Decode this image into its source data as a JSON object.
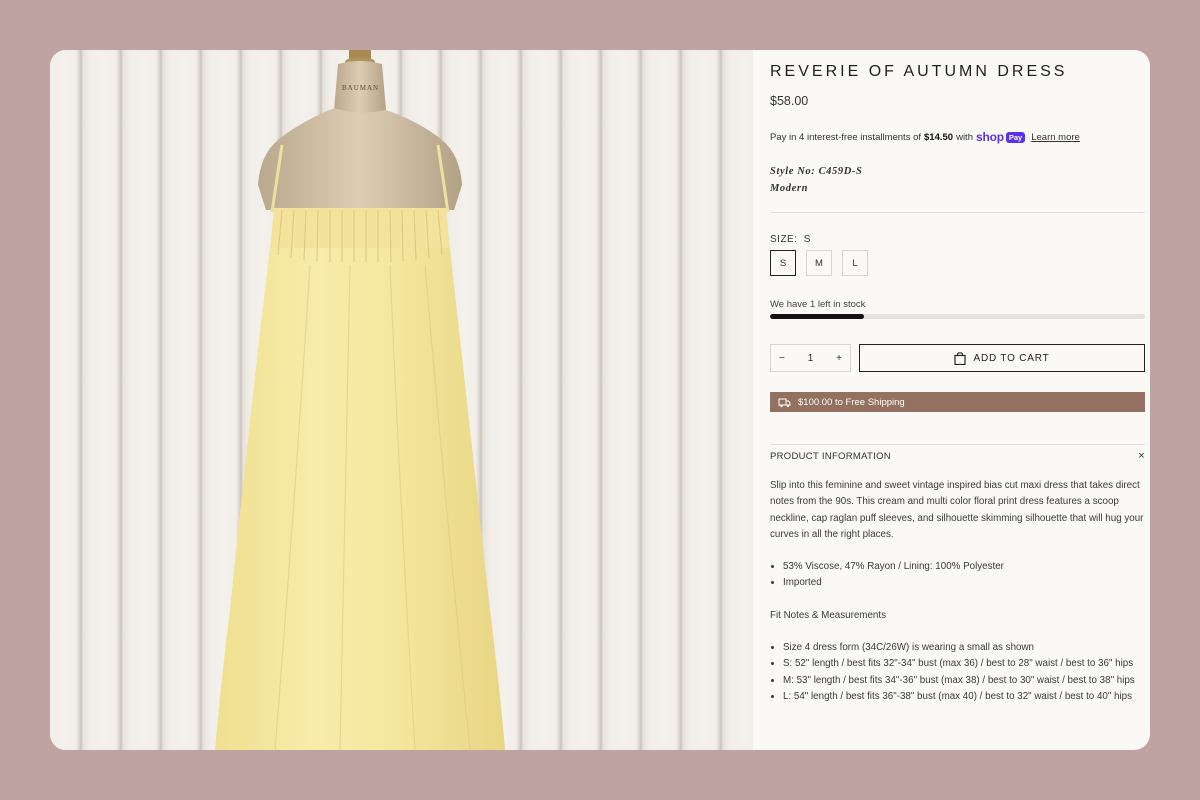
{
  "product": {
    "title": "REVERIE OF AUTUMN DRESS",
    "price": "$58.00",
    "installments": {
      "prefix": "Pay in 4 interest-free installments of",
      "amount": "$14.50",
      "suffix": "with",
      "shop_word": "shop",
      "pay_word": "Pay",
      "learn_more": "Learn more"
    },
    "style_no": "Style No: C459D-S",
    "style_category": "Modern",
    "form_label": "BAUMAN"
  },
  "size": {
    "label": "SIZE:",
    "selected": "S",
    "options": [
      "S",
      "M",
      "L"
    ]
  },
  "stock": {
    "text": "We have 1 left in stock",
    "level_fraction": 0.25
  },
  "quantity": {
    "minus": "−",
    "value": "1",
    "plus": "+"
  },
  "cart": {
    "label": "ADD TO CART"
  },
  "shipping": {
    "text": "$100.00 to Free Shipping",
    "color": "#93705f"
  },
  "info_section": {
    "header": "PRODUCT INFORMATION",
    "close": "×",
    "description": "Slip into this feminine and sweet vintage inspired bias cut maxi dress that takes direct notes from the 90s. This cream and multi color floral print dress features a scoop neckline, cap raglan puff sleeves, and silhouette skimming silhouette that will hug your curves in all the right places.",
    "materials": [
      "53% Viscose, 47% Rayon / Lining: 100% Polyester",
      "Imported"
    ],
    "fit_title": "Fit Notes & Measurements",
    "fit_notes": [
      "Size 4 dress form (34C/26W) is wearing a small as shown",
      "S: 52\" length / best fits 32\"-34\" bust (max 36) / best to 28\" waist / best to 36\" hips",
      "M: 53\" length / best fits 34\"-36\" bust (max 38) / best to 30\" waist / best to 38\" hips",
      "L: 54\" length / best fits 36\"-38\" bust (max 40) / best to 32\" waist / best to 40\" hips"
    ]
  },
  "colors": {
    "background": "#bfa3a3",
    "panel": "#fbf9f5",
    "dress": "#f5e79e",
    "shop_pay": "#5a31f4",
    "shipping_bar": "#93705f"
  }
}
